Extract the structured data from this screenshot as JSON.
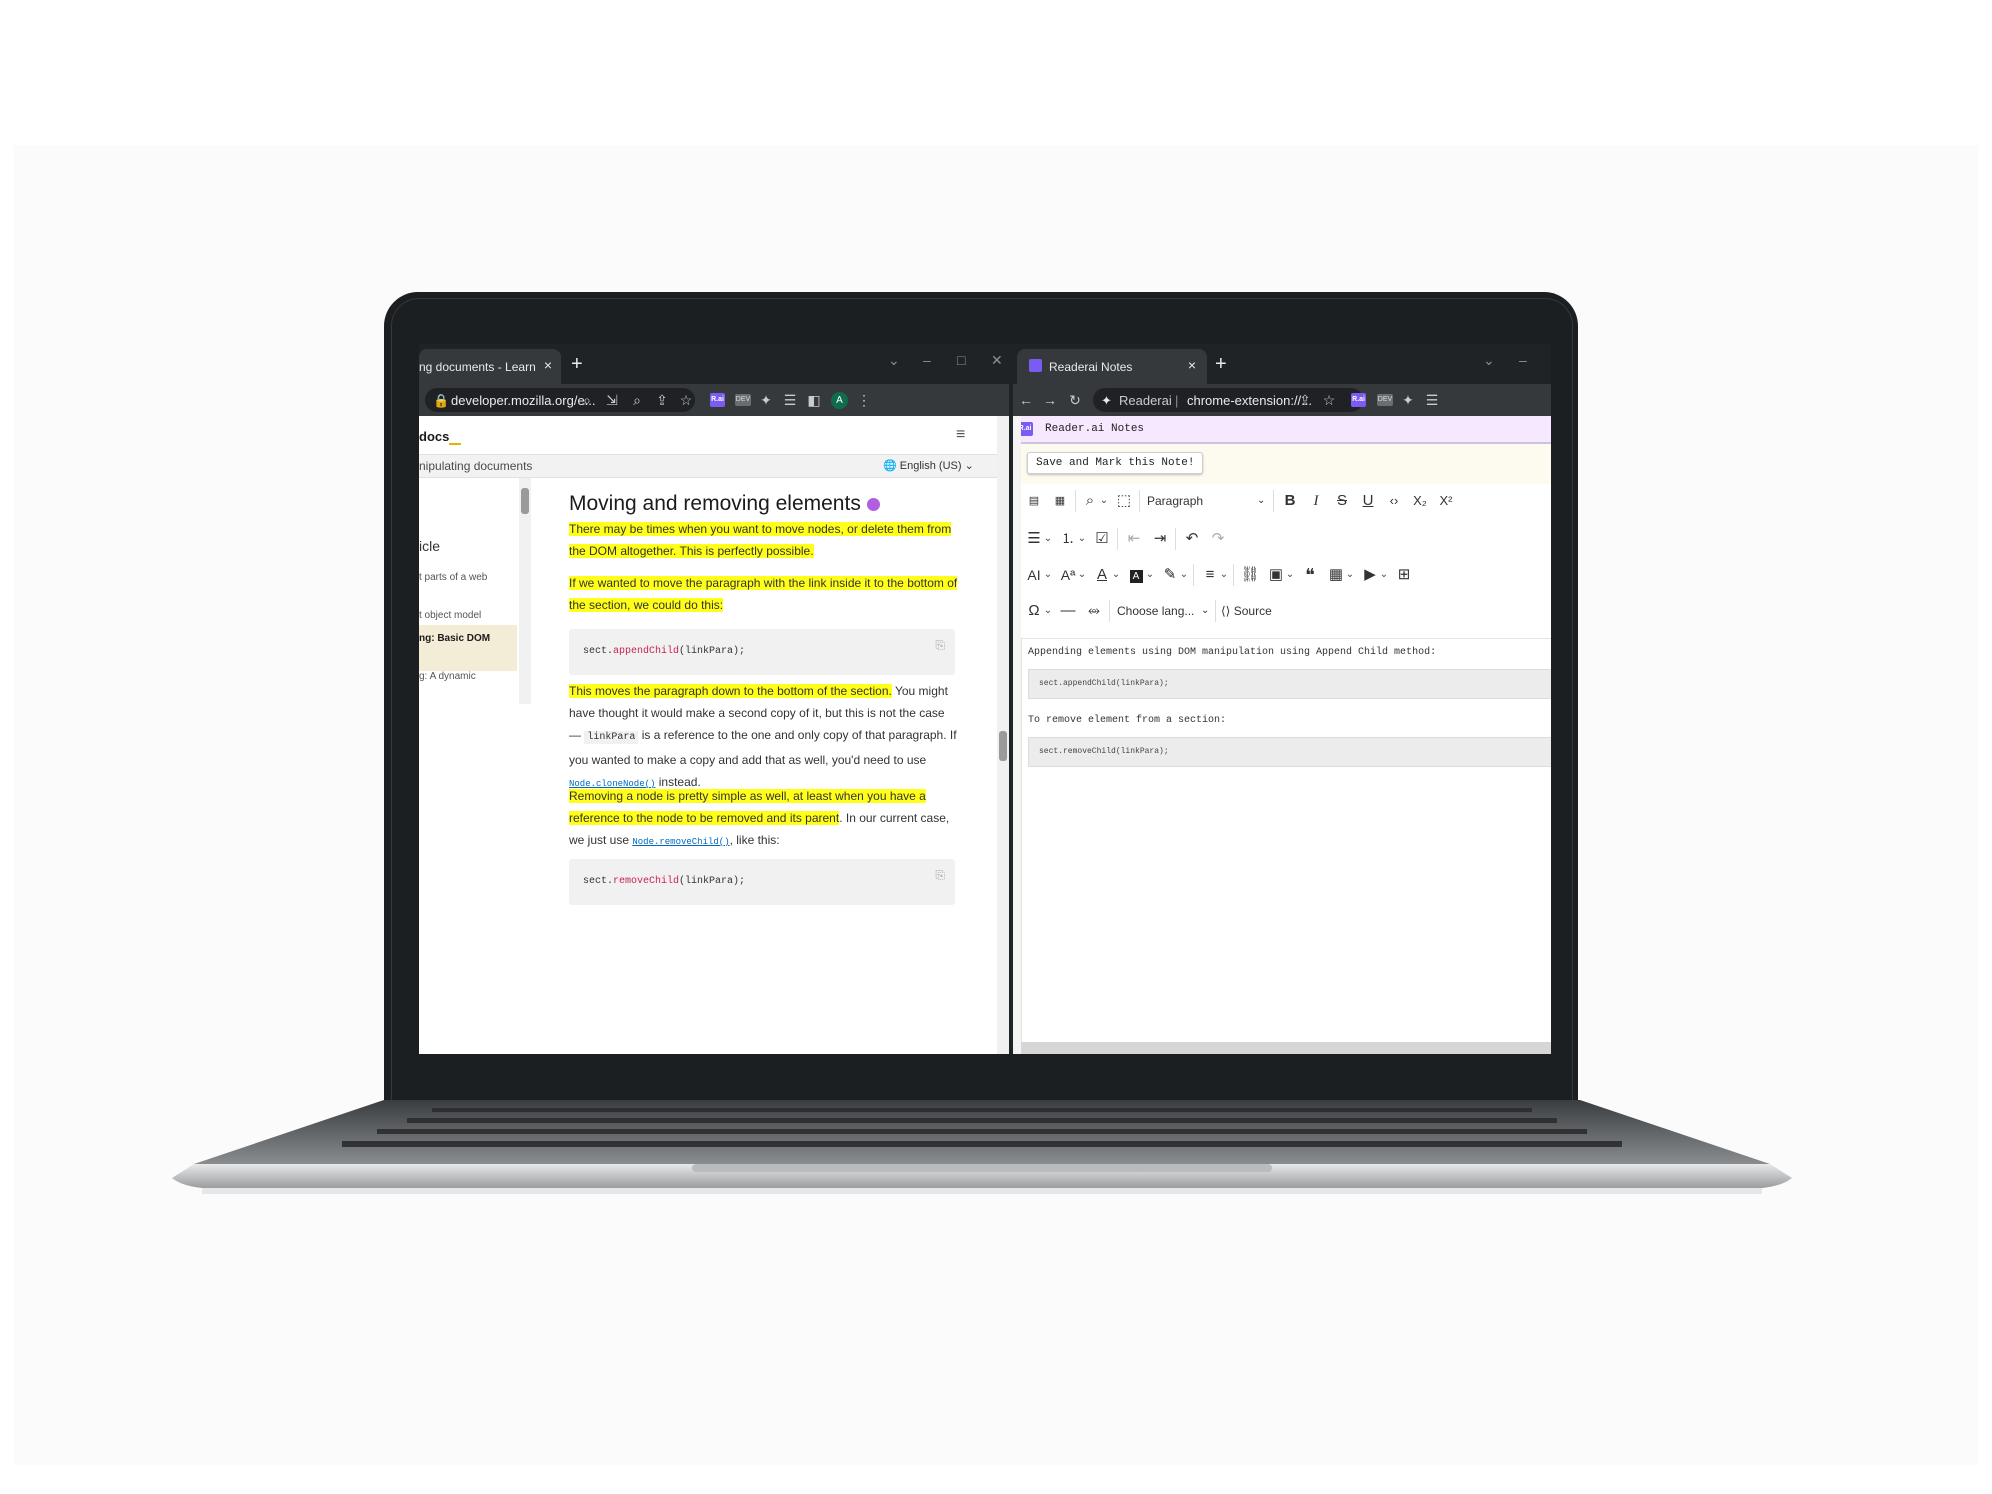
{
  "left_window": {
    "tab_title": "ng documents - Learn",
    "url": "developer.mozilla.org/e...",
    "avatar_letter": "A",
    "ext_label": "R.ai",
    "ext2_label": "DEV"
  },
  "mdn": {
    "logo": "docs",
    "breadcrumb": "nipulating documents",
    "language": "English (US)",
    "sidebar": [
      {
        "label": "icle"
      },
      {
        "label": "t parts of a web"
      },
      {
        "label": "t object model"
      },
      {
        "label": "ng: Basic DOM"
      },
      {
        "label": "g: A dynamic"
      }
    ],
    "title": "Moving and removing elements",
    "p1": "There may be times when you want to move nodes, or delete them from the DOM altogether. This is perfectly possible.",
    "p2": "If we wanted to move the paragraph with the link inside it to the bottom of the section, we could do this:",
    "code1_prefix": "sect.",
    "code1_method": "appendChild",
    "code1_suffix": "(linkPara);",
    "p3_hl": "This moves the paragraph down to the bottom of the section.",
    "p3_a": " You might have thought it would make a second copy of it, but this is not the case — ",
    "p3_code": "linkPara",
    "p3_b": " is a reference to the one and only copy of that paragraph. If you wanted to make a copy and add that as well, you'd need to use ",
    "p3_link": "Node.cloneNode()",
    "p3_c": " instead.",
    "p4_hl": "Removing a node is pretty simple as well, at least when you have a reference to the node to be removed and its parent",
    "p4_a": ". In our current case, we just use ",
    "p4_link": "Node.removeChild()",
    "p4_b": ", like this:",
    "code2_prefix": "sect.",
    "code2_method": "removeChild",
    "code2_suffix": "(linkPara);"
  },
  "right_window": {
    "tab_title": "Readerai Notes",
    "omni_site": "Readerai",
    "omni_url": "chrome-extension://...",
    "ext_label": "R.ai",
    "ext2_label": "DEV"
  },
  "notes": {
    "logo": "R.ai",
    "header_title": "Reader.ai Notes",
    "save_button": "Save and Mark this Note!",
    "toolbar": {
      "block_format": "Paragraph",
      "code_language": "Choose lang...",
      "source_label": "Source"
    },
    "line1": "Appending elements using DOM manipulation using Append Child method:",
    "code1": "sect.appendChild(linkPara);",
    "line2": "To remove element from a section:",
    "code2": "sect.removeChild(linkPara);"
  },
  "colors": {
    "highlight": "#ffff19",
    "brand_purple": "#7a5cf5",
    "notes_header": "#f6e8ff",
    "bezel": "#1c1f21"
  }
}
